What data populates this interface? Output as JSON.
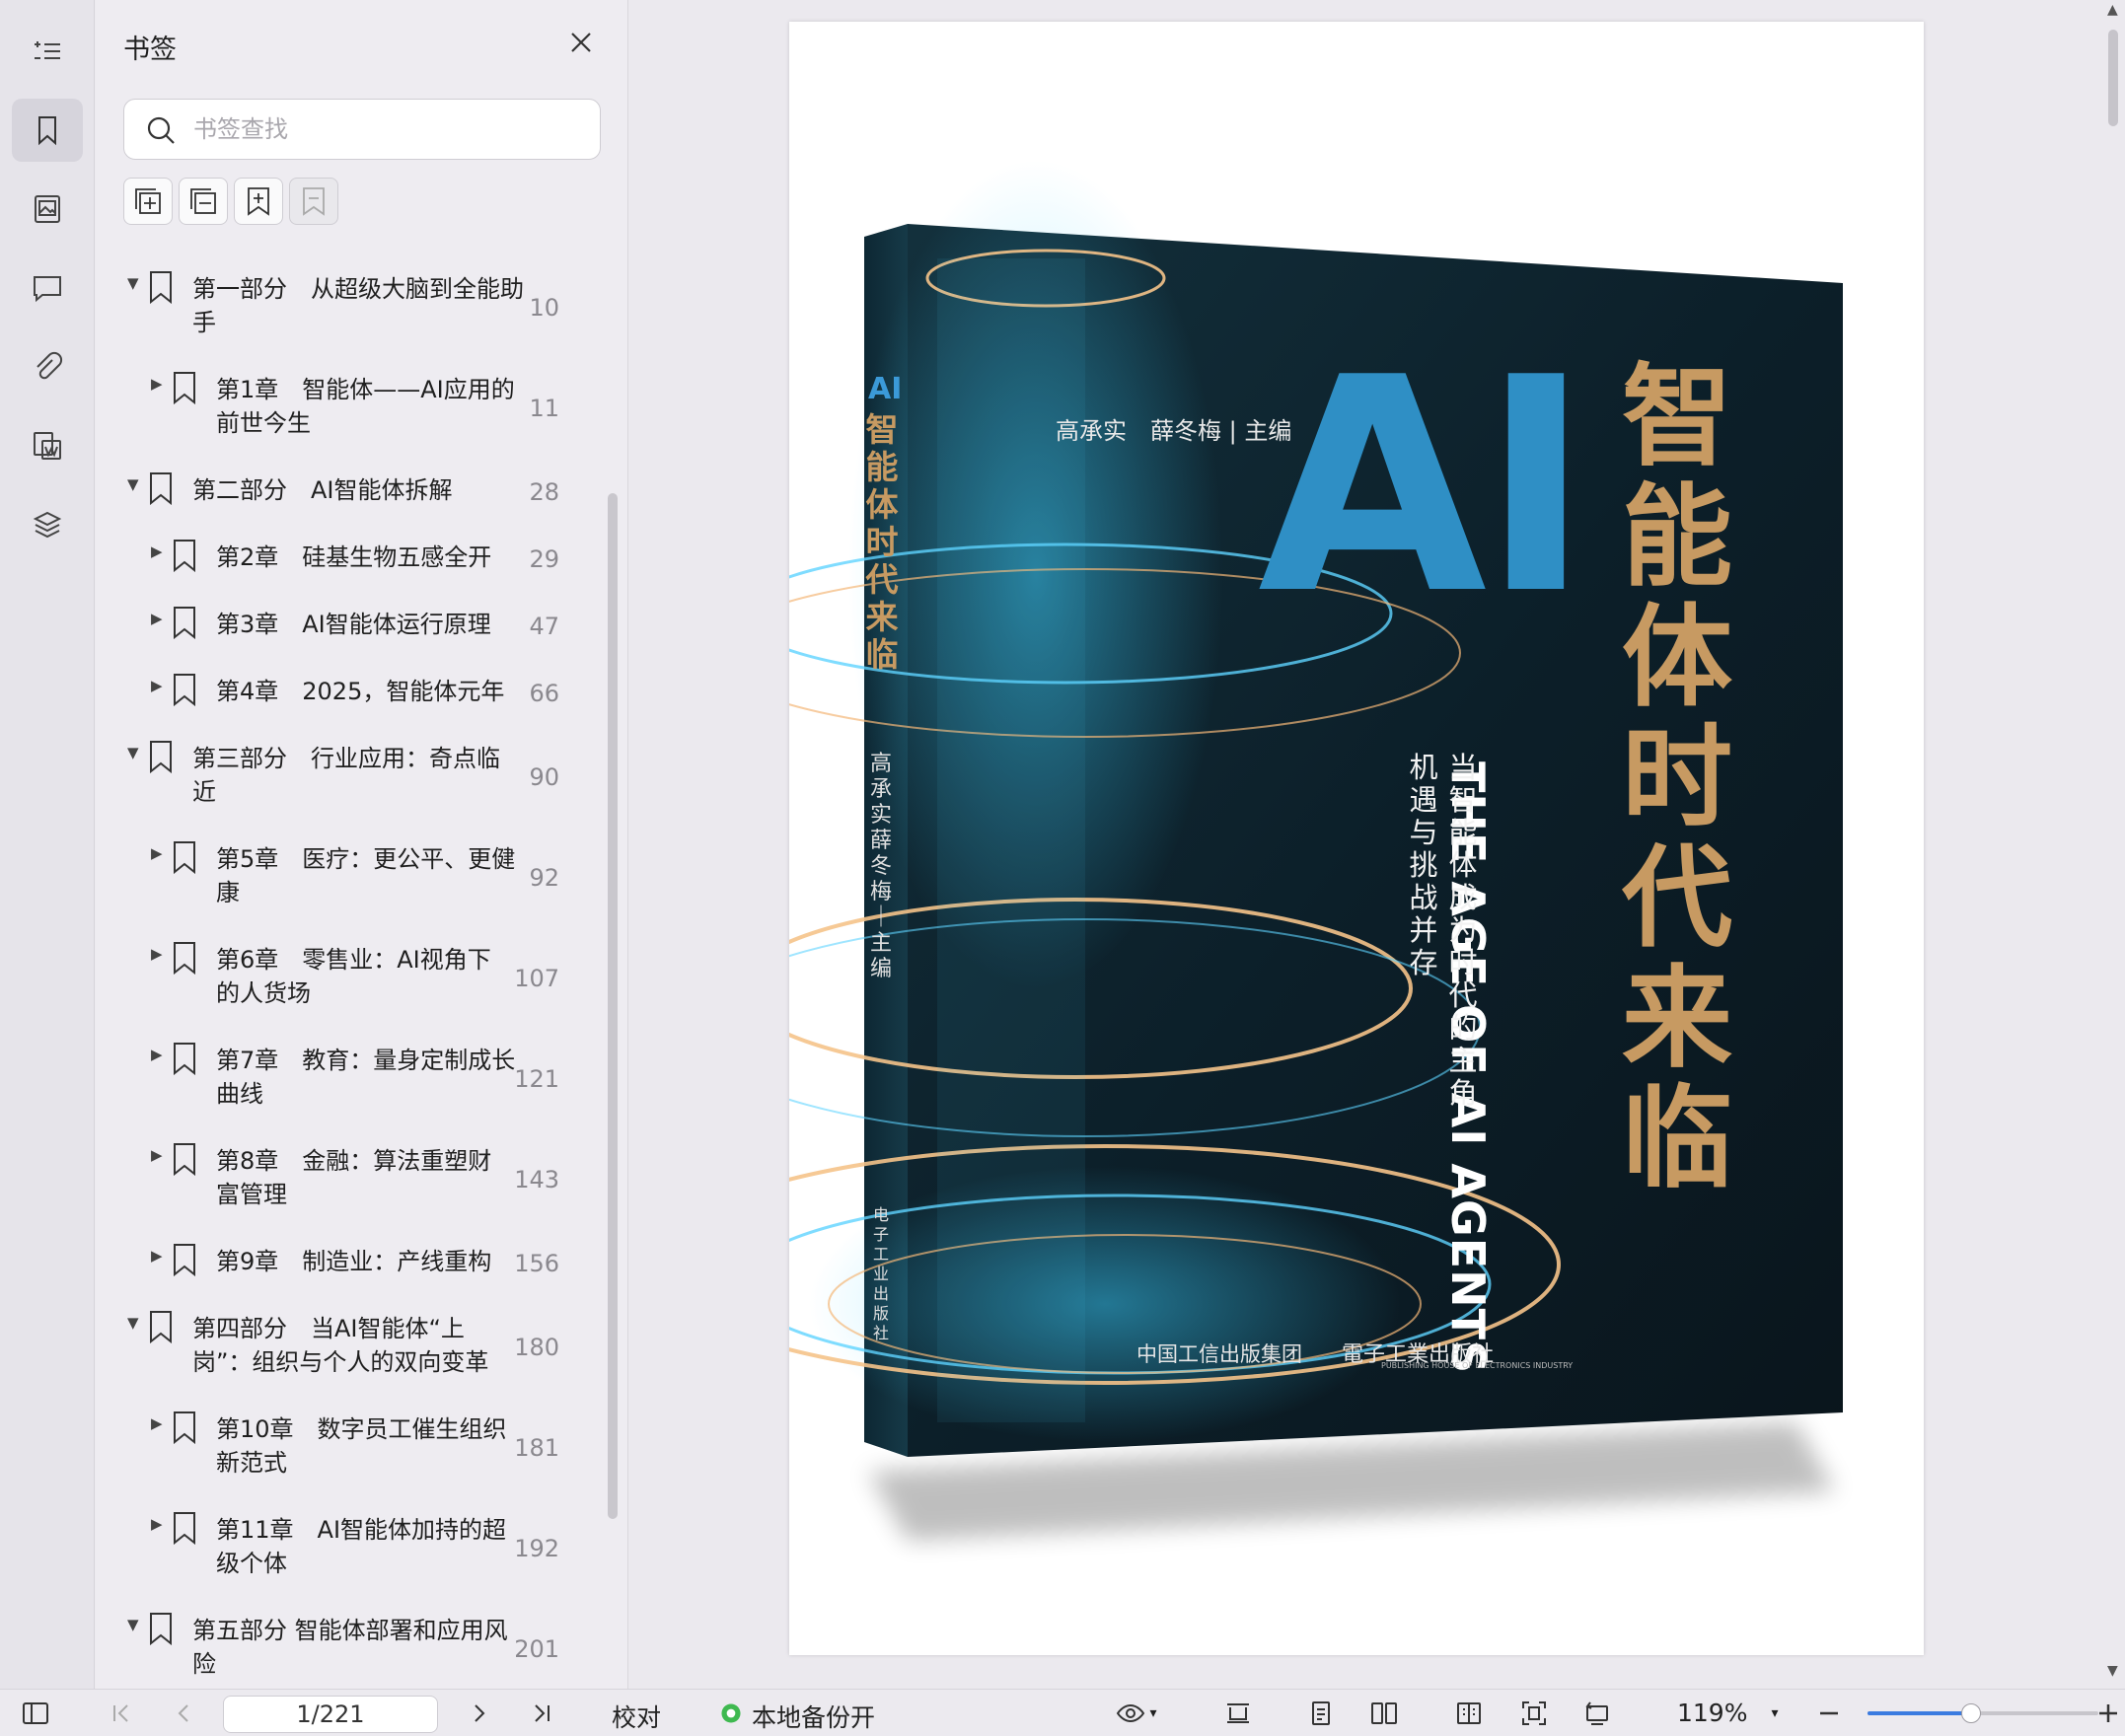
{
  "sidebar_panel": {
    "title": "书签",
    "search_placeholder": "书签查找",
    "bookmarks": [
      {
        "level": 0,
        "lines": [
          "第一部分　从超级大脑到全能助",
          "手"
        ],
        "page": "10",
        "expanded": true
      },
      {
        "level": 1,
        "lines": [
          "第1章　智能体——AI应用的",
          "前世今生"
        ],
        "page": "11",
        "expanded": false
      },
      {
        "level": 0,
        "lines": [
          "第二部分　AI智能体拆解"
        ],
        "page": "28",
        "expanded": true
      },
      {
        "level": 1,
        "lines": [
          "第2章　硅基生物五感全开"
        ],
        "page": "29",
        "expanded": false
      },
      {
        "level": 1,
        "lines": [
          "第3章　AI智能体运行原理"
        ],
        "page": "47",
        "expanded": false
      },
      {
        "level": 1,
        "lines": [
          "第4章　2025，智能体元年"
        ],
        "page": "66",
        "expanded": false
      },
      {
        "level": 0,
        "lines": [
          "第三部分　行业应用：奇点临",
          "近"
        ],
        "page": "90",
        "expanded": true
      },
      {
        "level": 1,
        "lines": [
          "第5章　医疗：更公平、更健",
          "康"
        ],
        "page": "92",
        "expanded": false
      },
      {
        "level": 1,
        "lines": [
          "第6章　零售业：AI视角下",
          "的人货场"
        ],
        "page": "107",
        "expanded": false
      },
      {
        "level": 1,
        "lines": [
          "第7章　教育：量身定制成长",
          "曲线"
        ],
        "page": "121",
        "expanded": false
      },
      {
        "level": 1,
        "lines": [
          "第8章　金融：算法重塑财",
          "富管理"
        ],
        "page": "143",
        "expanded": false
      },
      {
        "level": 1,
        "lines": [
          "第9章　制造业：产线重构"
        ],
        "page": "156",
        "expanded": false
      },
      {
        "level": 0,
        "lines": [
          "第四部分　当AI智能体“上",
          "岗”：组织与个人的双向变革"
        ],
        "page": "180",
        "expanded": true
      },
      {
        "level": 1,
        "lines": [
          "第10章　数字员工催生组织",
          "新范式"
        ],
        "page": "181",
        "expanded": false
      },
      {
        "level": 1,
        "lines": [
          "第11章　AI智能体加持的超",
          "级个体"
        ],
        "page": "192",
        "expanded": false
      },
      {
        "level": 0,
        "lines": [
          "第五部分 智能体部署和应用风",
          "险"
        ],
        "page": "201",
        "expanded": true
      }
    ]
  },
  "cover": {
    "title_ai": "AI",
    "title_cn": "智能体时代来临",
    "authors": "高承实　薛冬梅 | 主编",
    "english_title": "THE AGE OF AI AGENTS",
    "subtitle_line1": "当智能体成为时代的主角",
    "subtitle_line2": "机遇与挑战并存",
    "spine_ai": "AI",
    "spine_title": "智能体时代来临",
    "spine_authors": "高承实　薛冬梅｜主编",
    "spine_publisher": "电子工业出版社",
    "publisher_group": "中国工信出版集团",
    "publisher": "電子工業出版社",
    "publisher_en": "PUBLISHING HOUSE OF ELECTRONICS INDUSTRY"
  },
  "statusbar": {
    "page_input": "1/221",
    "proofread_label": "校对",
    "backup_label": "本地备份开",
    "zoom": "119%",
    "zoom_fraction": 0.45
  },
  "colors": {
    "accent": "#3b7be0",
    "backup_green": "#3fb950",
    "cover_blue": "#2f8fc5",
    "cover_gold": "#c79a62"
  }
}
